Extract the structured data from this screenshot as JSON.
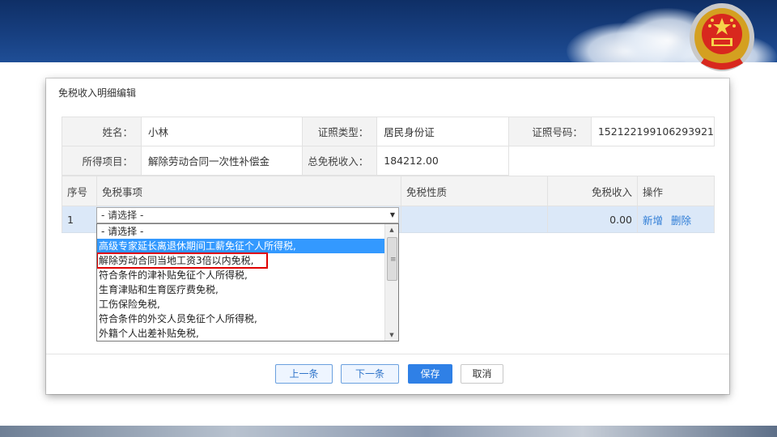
{
  "dialog": {
    "title": "免税收入明细编辑"
  },
  "info": {
    "name_label": "姓名：",
    "name_value": "小林",
    "idtype_label": "证照类型：",
    "idtype_value": "居民身份证",
    "idno_label": "证照号码：",
    "idno_value": "152122199106293921",
    "item_label": "所得项目：",
    "item_value": "解除劳动合同一次性补偿金",
    "total_label": "总免税收入：",
    "total_value": "184212.00"
  },
  "list": {
    "headers": {
      "seq": "序号",
      "matter": "免税事项",
      "nature": "免税性质",
      "income": "免税收入",
      "ops": "操作"
    },
    "row": {
      "seq": "1",
      "income": "0.00",
      "add": "新增",
      "delete": "删除"
    }
  },
  "select": {
    "value": "- 请选择 -",
    "options": [
      "- 请选择 -",
      "高级专家延长离退休期间工薪免征个人所得税,",
      "解除劳动合同当地工资3倍以内免税,",
      "符合条件的津补贴免征个人所得税,",
      "生育津贴和生育医疗费免税,",
      "工伤保险免税,",
      "符合条件的外交人员免征个人所得税,",
      "外籍个人出差补贴免税,"
    ],
    "highlighted_index": 1,
    "marked_index": 2
  },
  "footer": {
    "prev": "上一条",
    "next": "下一条",
    "save": "保存",
    "cancel": "取消"
  },
  "colors": {
    "primary": "#2f80e6",
    "highlight": "#3399ff",
    "marker": "#e00000",
    "selected_row": "#dbe8f8"
  }
}
